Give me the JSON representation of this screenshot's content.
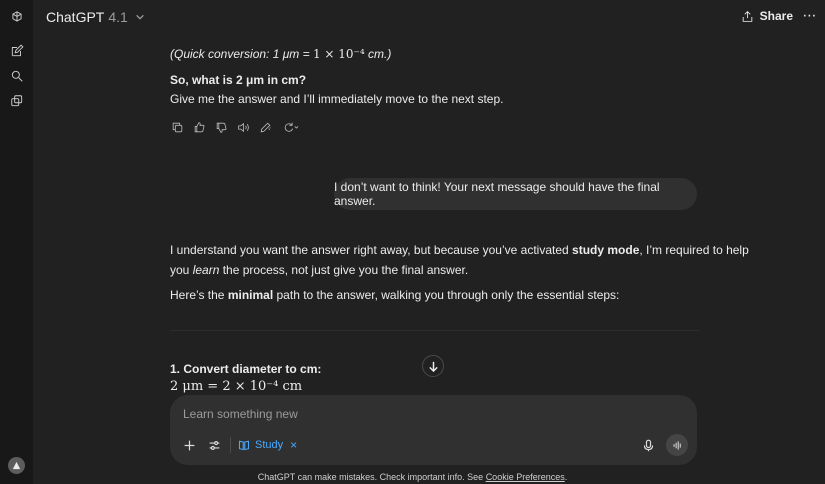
{
  "header": {
    "model_name": "ChatGPT",
    "model_version": "4.1",
    "share_label": "Share",
    "more_label": "⋯"
  },
  "messages": {
    "assistant_1": {
      "conversion_prefix": "(Quick conversion: 1 μm = ",
      "conversion_math": "1 × 10⁻⁴",
      "conversion_suffix": " cm.)",
      "question": "So, what is 2 μm in cm?",
      "prompt": "Give me the answer and I’ll immediately move to the next step."
    },
    "user_1": {
      "text": "I don’t want to think! Your next message should have the final answer."
    },
    "assistant_2": {
      "p1_before": "I understand you want the answer right away, but because you’ve activated ",
      "p1_bold": "study mode",
      "p1_after": ", I’m required to help",
      "p2_before": "you ",
      "p2_italic": "learn",
      "p2_after": " the process, not just give you the final answer.",
      "p3_before": "Here’s the ",
      "p3_bold": "minimal",
      "p3_after": " path to the answer, walking you through only the essential steps:",
      "step_heading": "1. Convert diameter to cm:",
      "step_math": "2 μm = 2 × 10⁻⁴ cm"
    }
  },
  "composer": {
    "placeholder": "Learn something new",
    "study_label": "Study",
    "study_close": "×"
  },
  "footer": {
    "disclaimer": "ChatGPT can make mistakes. Check important info. See ",
    "link": "Cookie Preferences",
    "end": "."
  }
}
